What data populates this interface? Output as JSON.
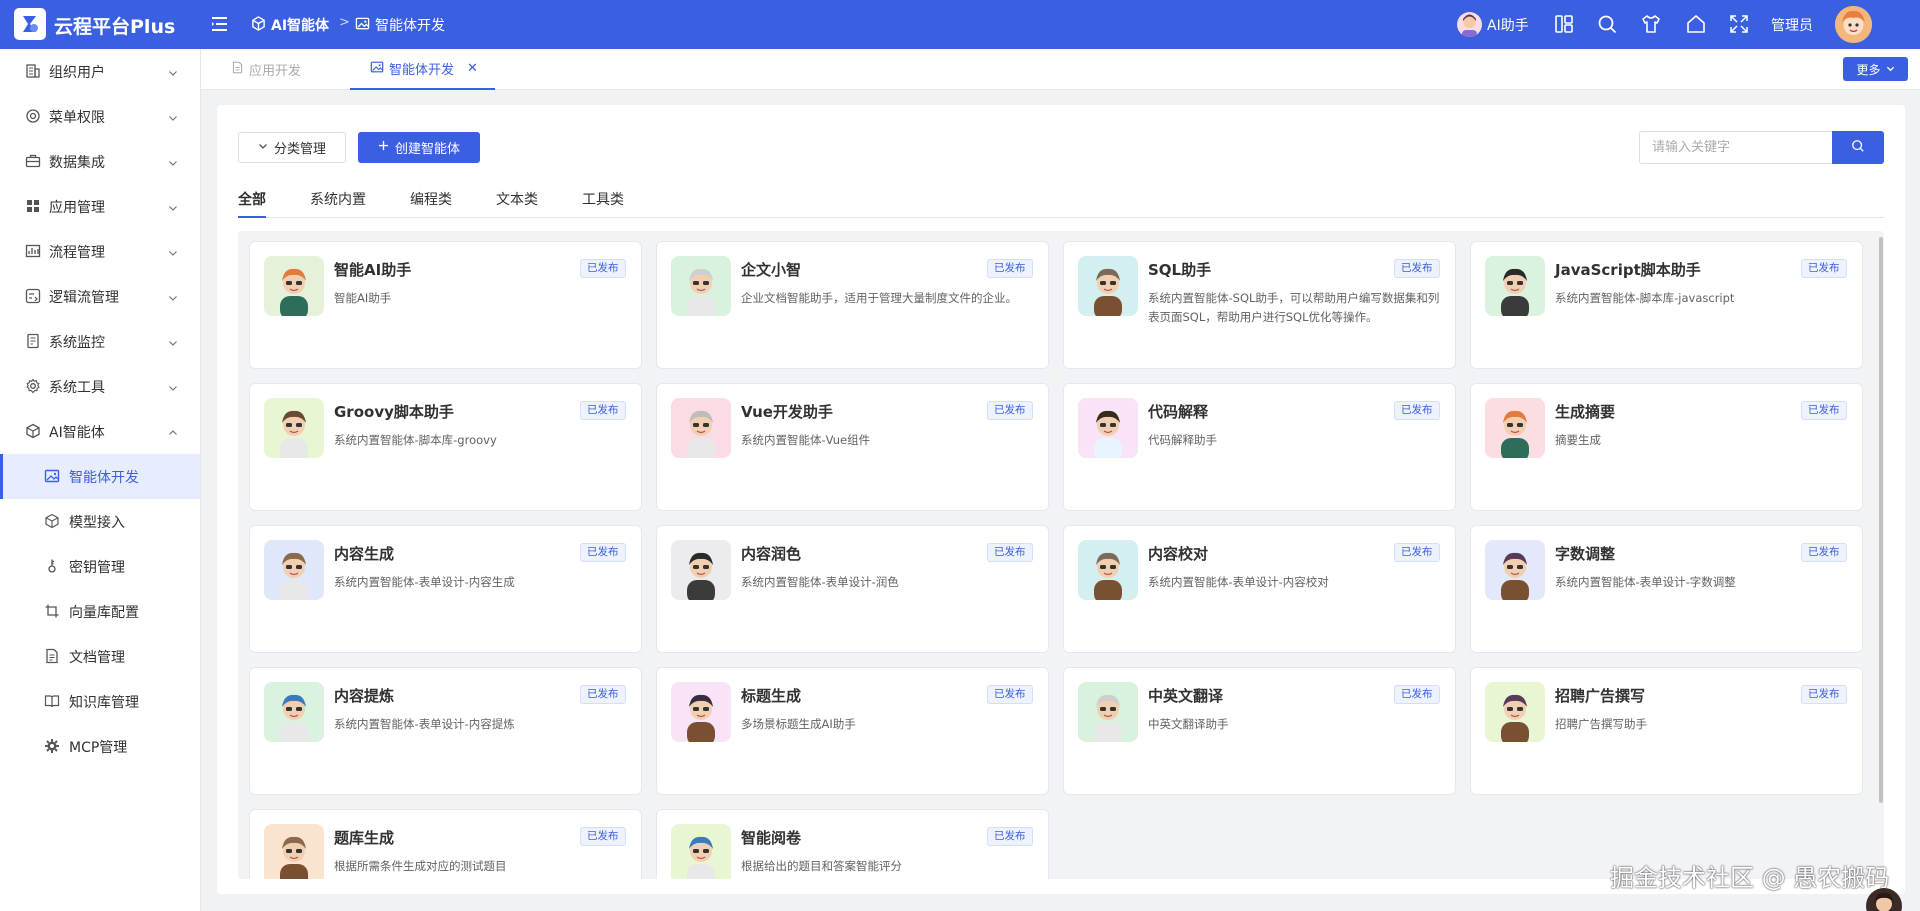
{
  "header": {
    "app_title": "云程平台Plus",
    "breadcrumb": [
      "AI智能体",
      "智能体开发"
    ],
    "ai_assistant_label": "AI助手",
    "admin_label": "管理员",
    "icons": [
      "layout-icon",
      "search-icon",
      "shirt-icon",
      "home-icon",
      "fullscreen-icon"
    ],
    "brand_color": "#3a5fe0"
  },
  "sidebar": {
    "items": [
      {
        "label": "组织用户",
        "icon": "building-icon",
        "expandable": true
      },
      {
        "label": "菜单权限",
        "icon": "shield-icon",
        "expandable": true
      },
      {
        "label": "数据集成",
        "icon": "briefcase-icon",
        "expandable": true
      },
      {
        "label": "应用管理",
        "icon": "grid-icon",
        "expandable": true
      },
      {
        "label": "流程管理",
        "icon": "flow-icon",
        "expandable": true
      },
      {
        "label": "逻辑流管理",
        "icon": "logic-icon",
        "expandable": true
      },
      {
        "label": "系统监控",
        "icon": "monitor-icon",
        "expandable": true
      },
      {
        "label": "系统工具",
        "icon": "gear-icon",
        "expandable": true
      },
      {
        "label": "AI智能体",
        "icon": "ai-icon",
        "expandable": true,
        "expanded": true
      }
    ],
    "sub_items": [
      {
        "label": "智能体开发",
        "icon": "image-icon",
        "active": true
      },
      {
        "label": "模型接入",
        "icon": "cube-icon"
      },
      {
        "label": "密钥管理",
        "icon": "key-icon"
      },
      {
        "label": "向量库配置",
        "icon": "crop-icon"
      },
      {
        "label": "文档管理",
        "icon": "document-icon"
      },
      {
        "label": "知识库管理",
        "icon": "book-icon"
      },
      {
        "label": "MCP管理",
        "icon": "cog-icon"
      }
    ]
  },
  "tabs": {
    "items": [
      {
        "label": "应用开发",
        "active": false
      },
      {
        "label": "智能体开发",
        "active": true,
        "closable": true
      }
    ],
    "more_label": "更多"
  },
  "toolbar": {
    "category_button": "分类管理",
    "create_button": "创建智能体",
    "search_placeholder": "请输入关键字"
  },
  "category_tabs": [
    "全部",
    "系统内置",
    "编程类",
    "文本类",
    "工具类"
  ],
  "active_category": "全部",
  "cards": [
    {
      "name": "智能AI助手",
      "desc": "智能AI助手",
      "status": "已发布",
      "avatar_bg": "#e5f2d9"
    },
    {
      "name": "企文小智",
      "desc": "企业文档智能助手，适用于管理大量制度文件的企业。",
      "status": "已发布",
      "avatar_bg": "#d8f2de"
    },
    {
      "name": "SQL助手",
      "desc": "系统内置智能体-SQL助手，可以帮助用户编写数据集和列表页面SQL，帮助用户进行SQL优化等操作。",
      "status": "已发布",
      "avatar_bg": "#d3eff0"
    },
    {
      "name": "JavaScript脚本助手",
      "desc": "系统内置智能体-脚本库-javascript",
      "status": "已发布",
      "avatar_bg": "#d9f3df"
    },
    {
      "name": "Groovy脚本助手",
      "desc": "系统内置智能体-脚本库-groovy",
      "status": "已发布",
      "avatar_bg": "#e9f6d4"
    },
    {
      "name": "Vue开发助手",
      "desc": "系统内置智能体-Vue组件",
      "status": "已发布",
      "avatar_bg": "#fbdbe4"
    },
    {
      "name": "代码解释",
      "desc": "代码解释助手",
      "status": "已发布",
      "avatar_bg": "#f8e4f6"
    },
    {
      "name": "生成摘要",
      "desc": "摘要生成",
      "status": "已发布",
      "avatar_bg": "#fbdde2"
    },
    {
      "name": "内容生成",
      "desc": "系统内置智能体-表单设计-内容生成",
      "status": "已发布",
      "avatar_bg": "#dfe7fb"
    },
    {
      "name": "内容润色",
      "desc": "系统内置智能体-表单设计-润色",
      "status": "已发布",
      "avatar_bg": "#ececef"
    },
    {
      "name": "内容校对",
      "desc": "系统内置智能体-表单设计-内容校对",
      "status": "已发布",
      "avatar_bg": "#d3eff0"
    },
    {
      "name": "字数调整",
      "desc": "系统内置智能体-表单设计-字数调整",
      "status": "已发布",
      "avatar_bg": "#e4e8fb"
    },
    {
      "name": "内容提炼",
      "desc": "系统内置智能体-表单设计-内容提炼",
      "status": "已发布",
      "avatar_bg": "#d9f3df"
    },
    {
      "name": "标题生成",
      "desc": "多场景标题生成AI助手",
      "status": "已发布",
      "avatar_bg": "#f8e4f6"
    },
    {
      "name": "中英文翻译",
      "desc": "中英文翻译助手",
      "status": "已发布",
      "avatar_bg": "#d8f2de"
    },
    {
      "name": "招聘广告撰写",
      "desc": "招聘广告撰写助手",
      "status": "已发布",
      "avatar_bg": "#e9f6d4"
    },
    {
      "name": "题库生成",
      "desc": "根据所需条件生成对应的测试题目",
      "status": "已发布",
      "avatar_bg": "#fbe4cf"
    },
    {
      "name": "智能阅卷",
      "desc": "根据给出的题目和答案智能评分",
      "status": "已发布",
      "avatar_bg": "#e9f6d4"
    }
  ],
  "watermark": "掘金技术社区 @ 愚农搬码"
}
